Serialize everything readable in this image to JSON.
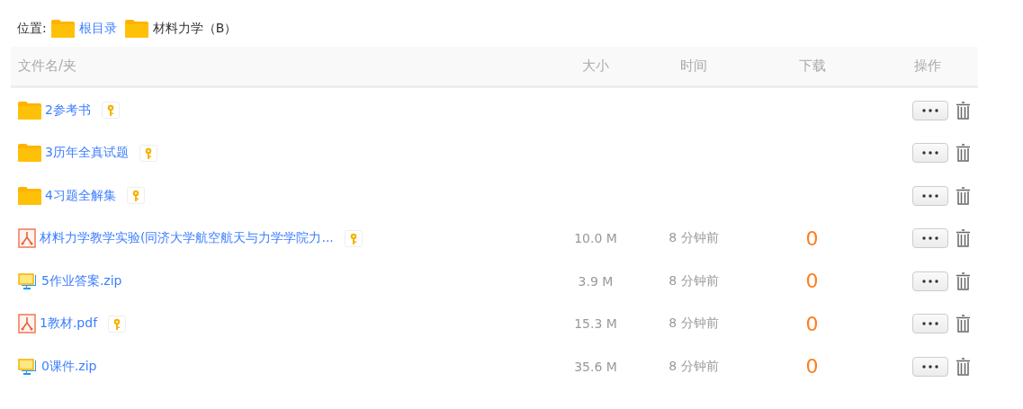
{
  "breadcrumb": {
    "label": "位置:",
    "items": [
      {
        "text": "根目录",
        "current": false
      },
      {
        "text": "材料力学（B）",
        "current": true
      }
    ]
  },
  "table": {
    "columns": [
      "文件名/夹",
      "大小",
      "时间",
      "下载",
      "操作"
    ],
    "rows": [
      {
        "kind": "folder",
        "name": "2参考书",
        "key": true
      },
      {
        "kind": "folder",
        "name": "3历年全真试题",
        "key": true
      },
      {
        "kind": "folder",
        "name": "4习题全解集",
        "key": true
      },
      {
        "kind": "pdf",
        "name": "材料力学教学实验(同济大学航空航天与力学学院力...",
        "key": true,
        "size": "10.0 M",
        "time": "8 分钟前",
        "downloads": "0"
      },
      {
        "kind": "zip",
        "name": "5作业答案.zip",
        "key": false,
        "size": "3.9 M",
        "time": "8 分钟前",
        "downloads": "0"
      },
      {
        "kind": "pdf",
        "name": "1教材.pdf",
        "key": true,
        "size": "15.3 M",
        "time": "8 分钟前",
        "downloads": "0"
      },
      {
        "kind": "zip",
        "name": "0课件.zip",
        "key": false,
        "size": "35.6 M",
        "time": "8 分钟前",
        "downloads": "0"
      }
    ]
  }
}
